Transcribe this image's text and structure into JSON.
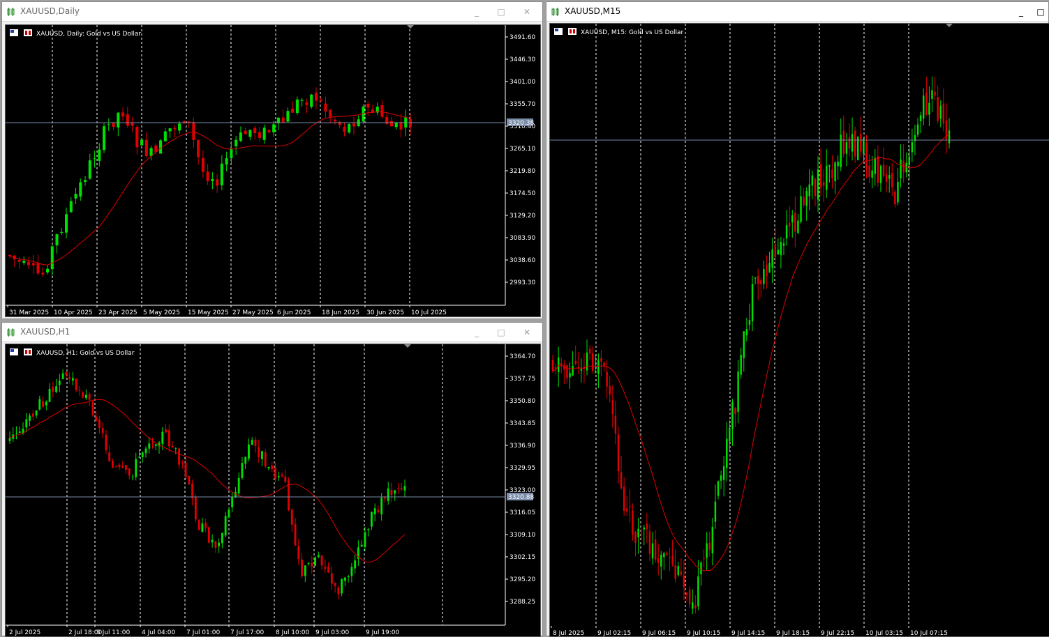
{
  "windows": [
    {
      "key": "daily",
      "title": "XAUUSD,Daily",
      "active": false,
      "chart_label": "XAUUSD, Daily:  Gold vs US Dollar",
      "y_ticks": [
        "3491.60",
        "3446.30",
        "3401.00",
        "3355.70",
        "3310.40",
        "3265.10",
        "3219.80",
        "3174.50",
        "3129.20",
        "3083.90",
        "3038.60",
        "2993.30"
      ],
      "x_ticks": [
        "31 Mar 2025",
        "10 Apr 2025",
        "23 Apr 2025",
        "5 May 2025",
        "15 May 2025",
        "27 May 2025",
        "6 Jun 2025",
        "18 Jun 2025",
        "30 Jun 2025",
        "10 Jul 2025"
      ],
      "price_label": "3320.38"
    },
    {
      "key": "h1",
      "title": "XAUUSD,H1",
      "active": false,
      "chart_label": "XAUUSD, H1:  Gold vs US Dollar",
      "y_ticks": [
        "3364.70",
        "3357.75",
        "3350.80",
        "3343.85",
        "3336.90",
        "3329.95",
        "3323.00",
        "3316.05",
        "3309.10",
        "3302.15",
        "3295.20",
        "3288.25"
      ],
      "x_ticks": [
        "2 Jul 2025",
        "2 Jul 18:00",
        "3 Jul 11:00",
        "4 Jul 04:00",
        "7 Jul 01:00",
        "7 Jul 17:00",
        "8 Jul 10:00",
        "9 Jul 03:00",
        "9 Jul 19:00"
      ],
      "price_label": "3320.88"
    },
    {
      "key": "m15",
      "title": "XAUUSD,M15",
      "active": true,
      "chart_label": "XAUUSD, M15:  Gold vs US Dollar",
      "y_ticks": [],
      "x_ticks": [
        "8 Jul 2025",
        "9 Jul 02:15",
        "9 Jul 06:15",
        "9 Jul 10:15",
        "9 Jul 14:15",
        "9 Jul 18:15",
        "9 Jul 22:15",
        "10 Jul 03:15",
        "10 Jul 07:15"
      ],
      "price_label": ""
    }
  ],
  "buttons": {
    "minimize": "_",
    "maximize": "□",
    "close": "✕"
  },
  "colors": {
    "bull": "#00e000",
    "bear": "#e00000",
    "ma": "#e00000",
    "grid": "#ffffff",
    "price_line": "#7a8ca8",
    "axis_text": "#ffffff"
  }
}
